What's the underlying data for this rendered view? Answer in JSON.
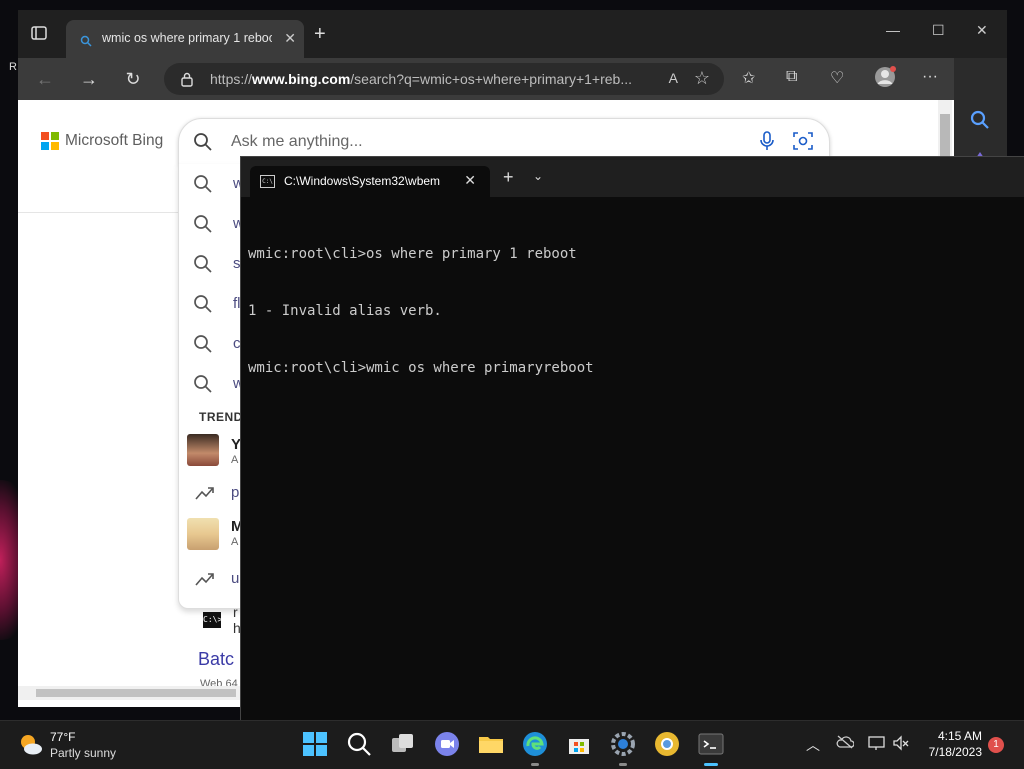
{
  "desktop": {
    "edge_label": "R"
  },
  "browser": {
    "tab_title": "wmic os where primary 1 reboot",
    "url_prefix": "https://",
    "url_domain": "www.bing.com",
    "url_rest": "/search?q=wmic+os+where+primary+1+reb...",
    "brand_name": "Microsoft Bing",
    "search_placeholder": "Ask me anything...",
    "suggestions": [
      "w",
      "w",
      "s",
      "fl",
      "c",
      "w"
    ],
    "trending_label": "TREND",
    "trending_items": [
      {
        "title": "Y",
        "subtitle": "A",
        "kind": "person"
      },
      {
        "title": "p",
        "subtitle": "",
        "kind": "trend"
      },
      {
        "title": "M",
        "subtitle": "A",
        "kind": "person"
      },
      {
        "title": "u",
        "subtitle": "",
        "kind": "trend"
      }
    ],
    "result_cmd_icon": "C:\\>",
    "result_partial_1": "r",
    "result_partial_2": "h",
    "result_link": "Batc",
    "result_tag": "Web  64"
  },
  "terminal": {
    "tab_title": "C:\\Windows\\System32\\wbem",
    "lines": [
      "wmic:root\\cli>os where primary 1 reboot",
      "1 - Invalid alias verb.",
      "wmic:root\\cli>wmic os where primaryreboot"
    ]
  },
  "taskbar": {
    "temperature": "77°F",
    "condition": "Partly sunny",
    "time": "4:15 AM",
    "date": "7/18/2023",
    "notification_count": "1"
  },
  "colors": {
    "accent": "#0067c0",
    "ms_red": "#f25022",
    "ms_green": "#7fba00",
    "ms_blue": "#00a4ef",
    "ms_yellow": "#ffb900"
  }
}
